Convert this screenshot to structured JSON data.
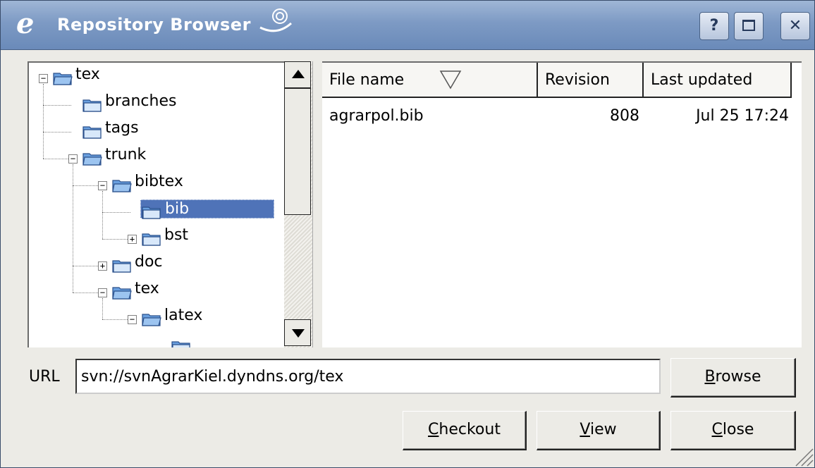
{
  "window": {
    "title": "Repository Browser",
    "app_icon_letter": "e",
    "help_label": "?",
    "close_label": "✕"
  },
  "tree": {
    "items": [
      {
        "label": "tex",
        "expander": "−"
      },
      {
        "label": "branches"
      },
      {
        "label": "tags"
      },
      {
        "label": "trunk",
        "expander": "−"
      },
      {
        "label": "bibtex",
        "expander": "−"
      },
      {
        "label": "bib",
        "selected": true
      },
      {
        "label": "bst",
        "expander": "+"
      },
      {
        "label": "doc",
        "expander": "+"
      },
      {
        "label": "tex",
        "expander": "−"
      },
      {
        "label": "latex",
        "expander": "−"
      }
    ]
  },
  "file_list": {
    "columns": [
      "File name",
      "Revision",
      "Last updated"
    ],
    "rows": [
      {
        "name": "agrarpol.bib",
        "revision": "808",
        "updated": "Jul 25 17:24"
      }
    ]
  },
  "url": {
    "label": "URL",
    "value": "svn://svnAgrarKiel.dyndns.org/tex"
  },
  "buttons": {
    "browse": {
      "mnemonic": "B",
      "rest": "rowse"
    },
    "checkout": {
      "mnemonic": "C",
      "rest": "heckout"
    },
    "view": {
      "mnemonic": "V",
      "rest": "iew"
    },
    "close": {
      "mnemonic": "C",
      "rest": "lose"
    }
  },
  "colors": {
    "titlebar": "#7d9ac4",
    "selection": "#4f73b8",
    "folder": "#6aa0e0"
  }
}
